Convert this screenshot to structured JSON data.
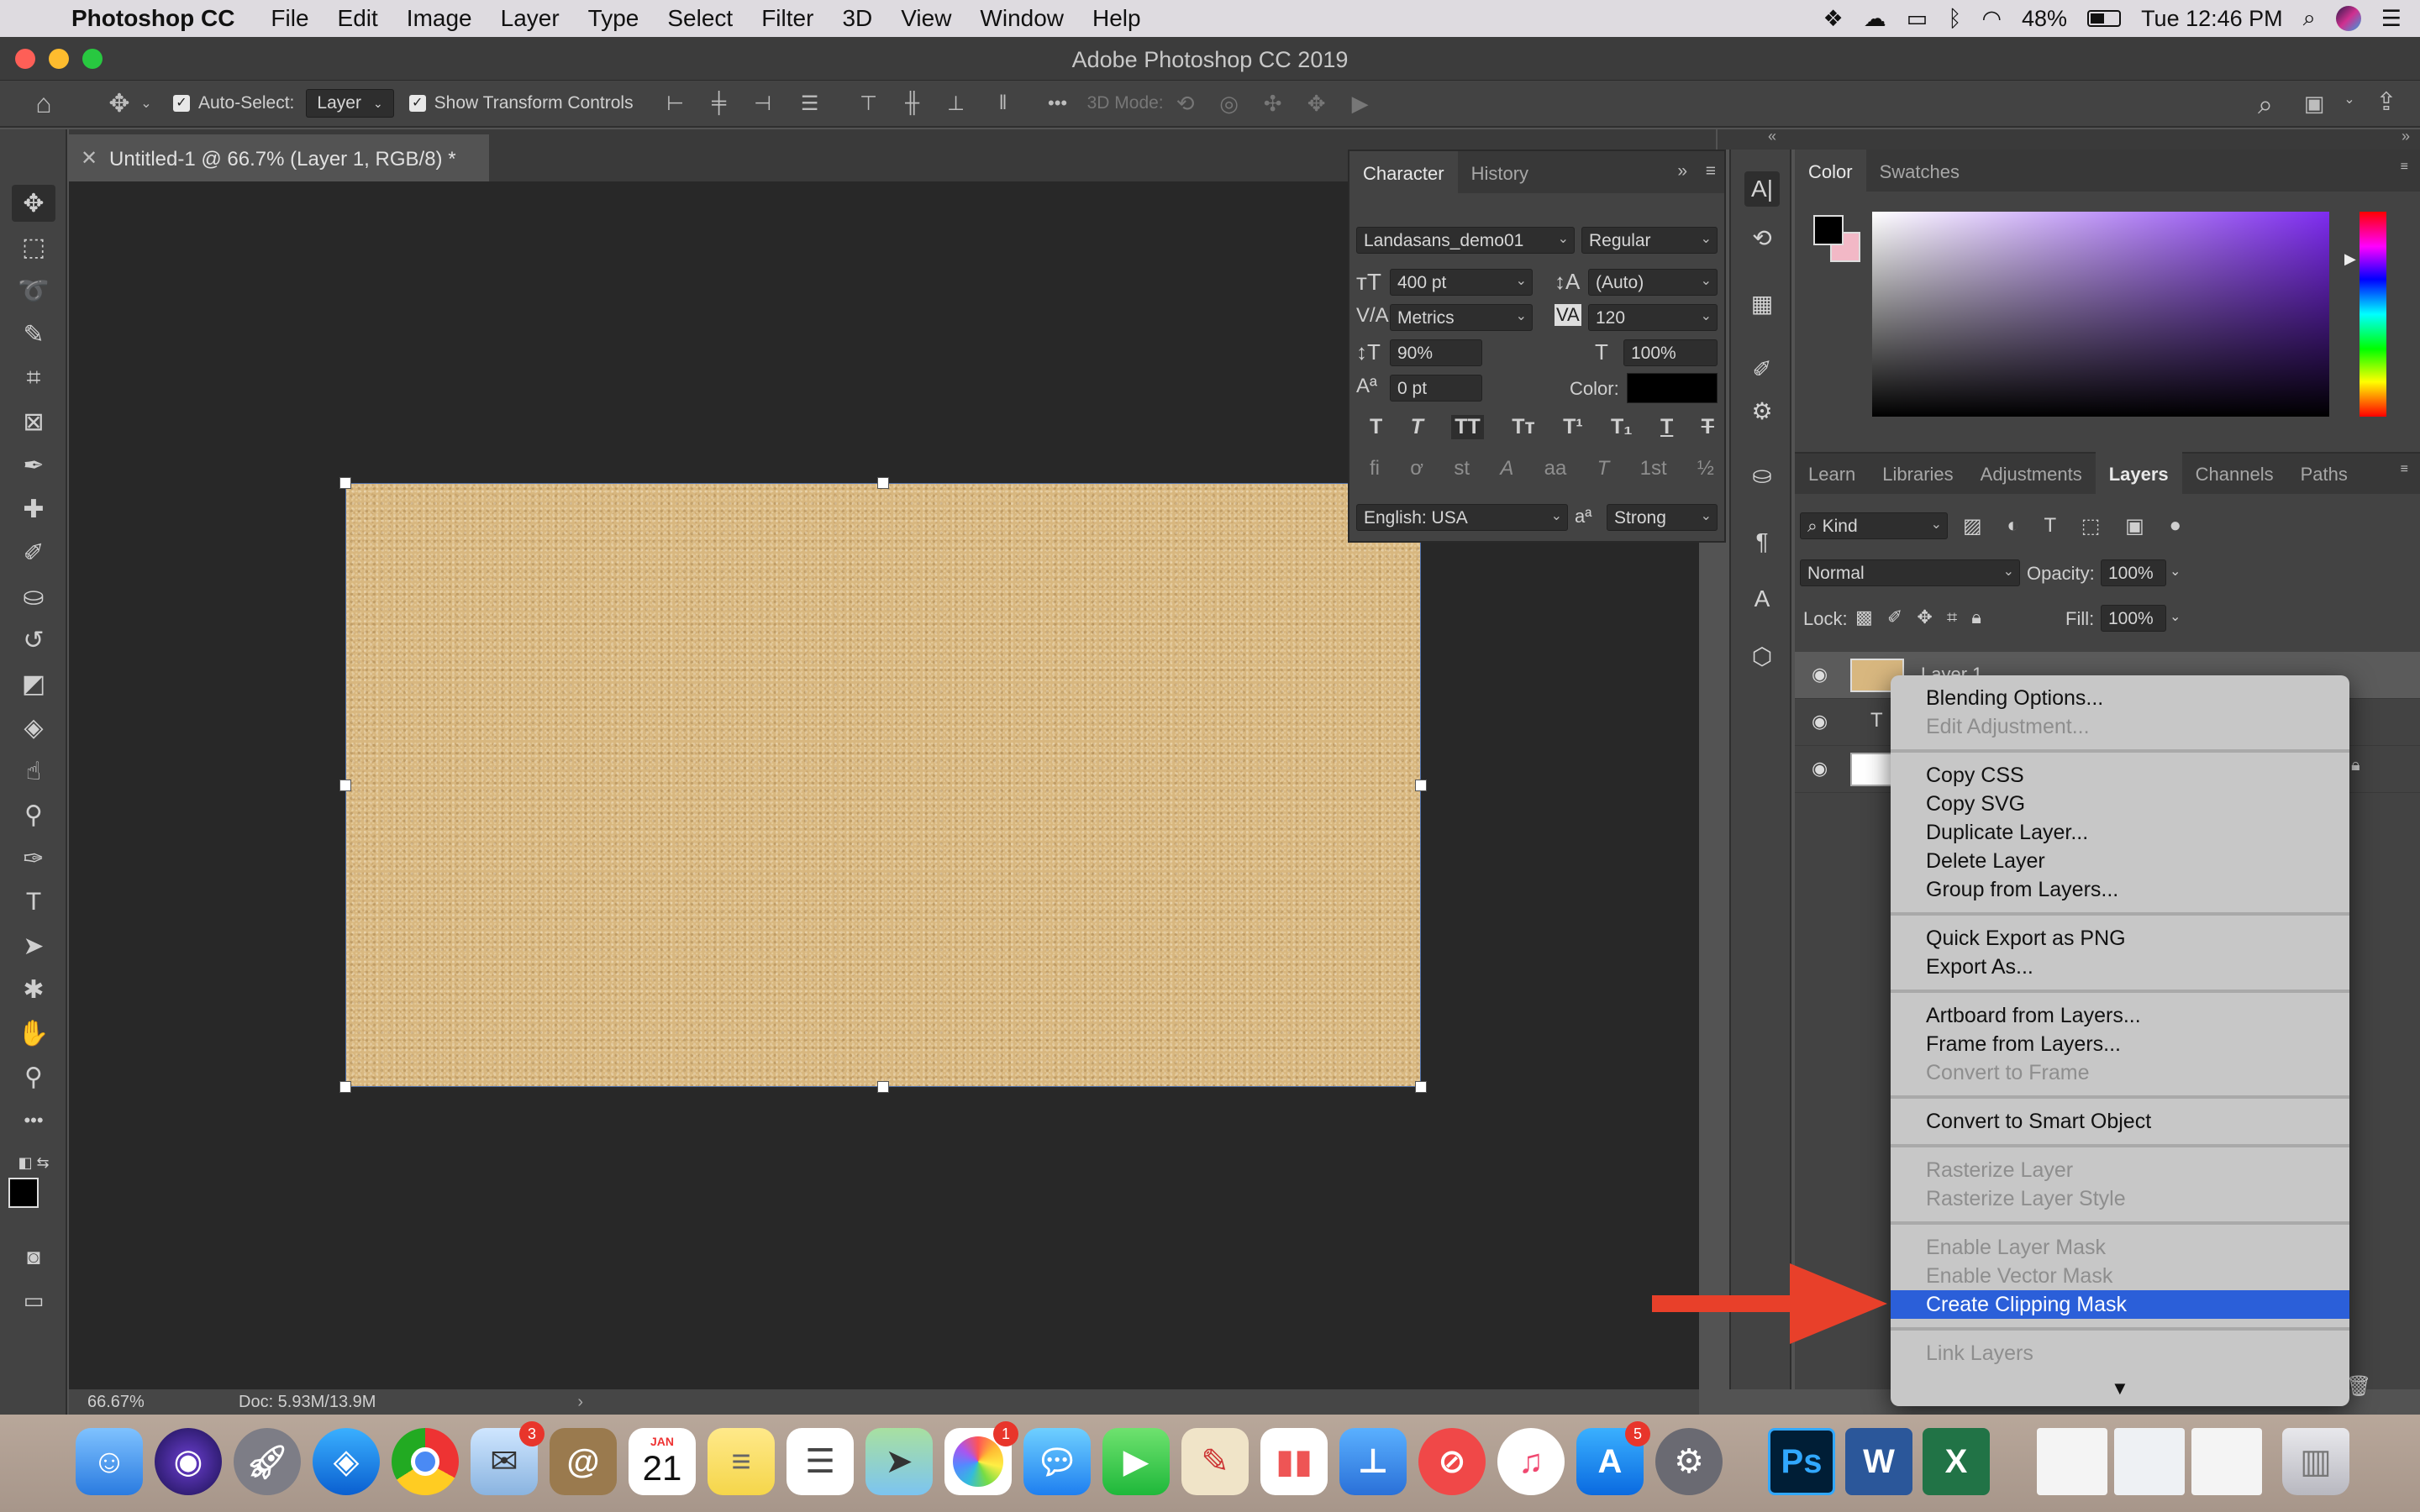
{
  "menubar": {
    "app_name": "Photoshop CC",
    "items": [
      "File",
      "Edit",
      "Image",
      "Layer",
      "Type",
      "Select",
      "Filter",
      "3D",
      "View",
      "Window",
      "Help"
    ],
    "battery": "48%",
    "clock": "Tue 12:46 PM"
  },
  "window": {
    "title": "Adobe Photoshop CC 2019"
  },
  "options": {
    "auto_select_label": "Auto-Select:",
    "auto_select_value": "Layer",
    "show_transform_label": "Show Transform Controls",
    "mode_3d_label": "3D Mode:",
    "more": "•••"
  },
  "document": {
    "tab_title": "Untitled-1 @ 66.7% (Layer 1, RGB/8) *",
    "zoom": "66.67%",
    "doc_size": "Doc: 5.93M/13.9M"
  },
  "character": {
    "tabs": [
      "Character",
      "History"
    ],
    "font_family": "Landasans_demo01",
    "font_style": "Regular",
    "size": "400 pt",
    "leading": "(Auto)",
    "kerning": "Metrics",
    "tracking": "120",
    "vscale": "90%",
    "hscale": "100%",
    "baseline": "0 pt",
    "color_label": "Color:",
    "language": "English: USA",
    "aa_label": "aₐ",
    "antialias": "Strong",
    "style_buttons": [
      "T",
      "T",
      "TT",
      "Tт",
      "T¹",
      "T₁",
      "T",
      "T"
    ],
    "ot_buttons": [
      "fi",
      "ơ",
      "st",
      "A",
      "aa",
      "T",
      "1st",
      "½"
    ]
  },
  "color_panel": {
    "tabs": [
      "Color",
      "Swatches"
    ]
  },
  "layers_panel": {
    "tabs": [
      "Learn",
      "Libraries",
      "Adjustments",
      "Layers",
      "Channels",
      "Paths"
    ],
    "filter_kind": "Kind",
    "blend_mode": "Normal",
    "opacity_label": "Opacity:",
    "opacity": "100%",
    "lock_label": "Lock:",
    "fill_label": "Fill:",
    "fill": "100%",
    "layers": [
      {
        "name": "Layer 1",
        "type": "pixel"
      },
      {
        "name": "",
        "type": "text"
      },
      {
        "name": "",
        "type": "background"
      }
    ]
  },
  "context_menu": {
    "items": [
      {
        "label": "Blending Options...",
        "enabled": true
      },
      {
        "label": "Edit Adjustment...",
        "enabled": false
      },
      {
        "label": "Copy CSS",
        "enabled": true
      },
      {
        "label": "Copy SVG",
        "enabled": true
      },
      {
        "label": "Duplicate Layer...",
        "enabled": true
      },
      {
        "label": "Delete Layer",
        "enabled": true
      },
      {
        "label": "Group from Layers...",
        "enabled": true
      },
      {
        "label": "Quick Export as PNG",
        "enabled": true
      },
      {
        "label": "Export As...",
        "enabled": true
      },
      {
        "label": "Artboard from Layers...",
        "enabled": true
      },
      {
        "label": "Frame from Layers...",
        "enabled": true
      },
      {
        "label": "Convert to Frame",
        "enabled": false
      },
      {
        "label": "Convert to Smart Object",
        "enabled": true
      },
      {
        "label": "Rasterize Layer",
        "enabled": false
      },
      {
        "label": "Rasterize Layer Style",
        "enabled": false
      },
      {
        "label": "Enable Layer Mask",
        "enabled": false
      },
      {
        "label": "Enable Vector Mask",
        "enabled": false
      },
      {
        "label": "Create Clipping Mask",
        "enabled": true,
        "highlighted": true
      },
      {
        "label": "Link Layers",
        "enabled": false
      }
    ]
  },
  "dock": {
    "badges": {
      "mail": "3",
      "photos": "1",
      "appstore": "5"
    },
    "calendar_month": "JAN",
    "calendar_day": "21",
    "ps": "Ps",
    "word": "W",
    "excel": "X"
  },
  "colors": {
    "accent_highlight": "#2b5fd9",
    "arrow": "#e8402a",
    "canvas_sand": "#d8b77f"
  }
}
